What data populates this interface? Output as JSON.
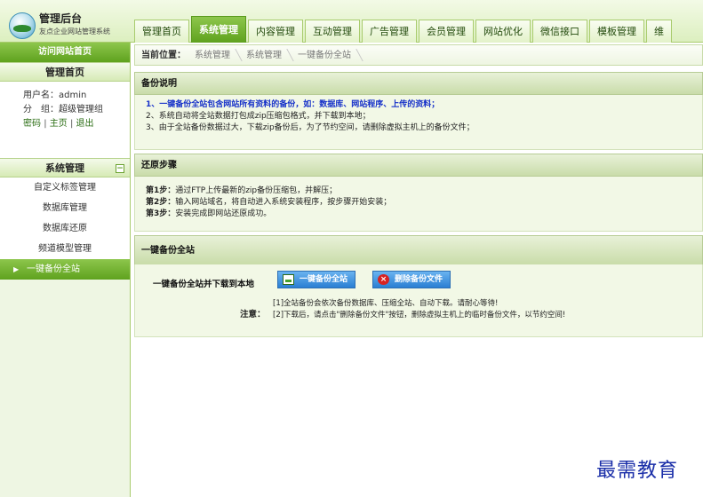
{
  "header": {
    "title": "管理后台",
    "subtitle": "友点企业网站管理系统"
  },
  "nav": {
    "tabs": [
      "管理首页",
      "系统管理",
      "内容管理",
      "互动管理",
      "广告管理",
      "会员管理",
      "网站优化",
      "微信接口",
      "模板管理",
      "维"
    ],
    "active_index": 1
  },
  "sidebar": {
    "visit_site": "访问网站首页",
    "home_title": "管理首页",
    "user_label": "用户名：",
    "user_name": "admin",
    "group_label": "分　组：",
    "group_name": "超级管理组",
    "links": [
      "密码",
      "主页",
      "退出"
    ],
    "link_sep": "|",
    "section_title": "系统管理",
    "collapse_glyph": "−",
    "menu": [
      "自定义标签管理",
      "数据库管理",
      "数据库还原",
      "频道模型管理",
      "一键备份全站"
    ],
    "active_menu_index": 4
  },
  "breadcrumb": {
    "label": "当前位置：",
    "items": [
      "系统管理",
      "系统管理",
      "一键备份全站"
    ]
  },
  "backup_desc": {
    "heading": "备份说明",
    "line1_prefix": "1、",
    "line1_text": "一键备份全站包含网站所有资料的备份，如：数据库、网站程序、上传的资料；",
    "line2": "2、系统自动将全站数据打包成zip压缩包格式，并下载到本地；",
    "line3": "3、由于全站备份数据过大，下载zip备份后，为了节约空间，请删除虚拟主机上的备份文件；"
  },
  "restore": {
    "heading": "还原步骤",
    "steps": [
      {
        "label": "第1步：",
        "text": "通过FTP上传最新的zip备份压缩包，并解压；"
      },
      {
        "label": "第2步：",
        "text": "输入网站域名，将自动进入系统安装程序，按步骤开始安装；"
      },
      {
        "label": "第3步：",
        "text": "安装完成即网站还原成功。"
      }
    ]
  },
  "one_click": {
    "heading": "一键备份全站",
    "row_label": "一键备份全站并下载到本地",
    "backup_button": "一键备份全站",
    "delete_button": "删除备份文件",
    "delete_glyph": "×",
    "note_label": "注意：",
    "note1": "[1]全站备份会依次备份数据库、压缩全站、自动下载。请耐心等待!",
    "note2": "[2]下载后，请点击\"删除备份文件\"按钮，删除虚拟主机上的临时备份文件，以节约空间!"
  },
  "watermark": "最需教育",
  "colors": {
    "accent_green": "#5fa21e",
    "link_blue": "#1530c9",
    "button_blue": "#2a7fd3",
    "delete_red": "#d82222"
  }
}
